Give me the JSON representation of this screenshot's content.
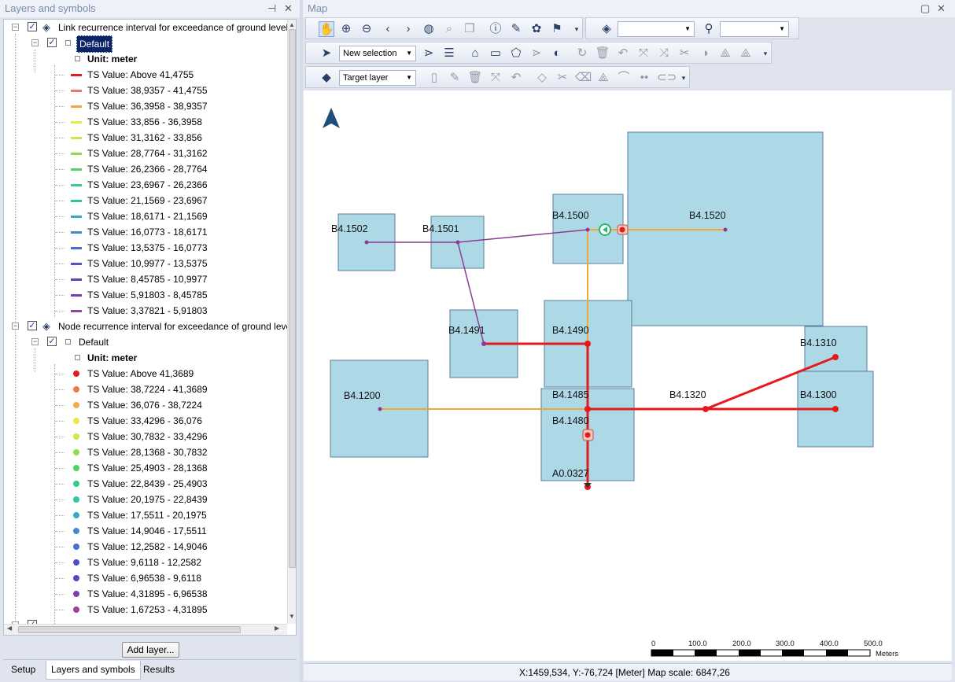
{
  "left_panel": {
    "title": "Layers and symbols",
    "layer1": {
      "name": "Link recurrence interval for exceedance of ground levels",
      "group": "Default",
      "unit": "Unit: meter",
      "items": [
        {
          "label": "TS Value: Above 41,4755",
          "color": "#e41a1c"
        },
        {
          "label": "TS Value: 38,9357 - 41,4755",
          "color": "#f0746a"
        },
        {
          "label": "TS Value: 36,3958 - 38,9357",
          "color": "#f5a442"
        },
        {
          "label": "TS Value: 33,856 - 36,3958",
          "color": "#eaea4a"
        },
        {
          "label": "TS Value: 31,3162 - 33,856",
          "color": "#c6e84a"
        },
        {
          "label": "TS Value: 28,7764 - 31,3162",
          "color": "#8cdc50"
        },
        {
          "label": "TS Value: 26,2366 - 28,7764",
          "color": "#58d060"
        },
        {
          "label": "TS Value: 23,6967 - 26,2366",
          "color": "#3ccc82"
        },
        {
          "label": "TS Value: 21,1569 - 23,6967",
          "color": "#33c1a6"
        },
        {
          "label": "TS Value: 18,6171 - 21,1569",
          "color": "#3aa8c8"
        },
        {
          "label": "TS Value: 16,0773 - 18,6171",
          "color": "#4488cc"
        },
        {
          "label": "TS Value: 13,5375 - 16,0773",
          "color": "#4a6ecf"
        },
        {
          "label": "TS Value: 10,9977 - 13,5375",
          "color": "#4c54c8"
        },
        {
          "label": "TS Value: 8,45785 - 10,9977",
          "color": "#5646be"
        },
        {
          "label": "TS Value: 5,91803 - 8,45785",
          "color": "#7040b4"
        },
        {
          "label": "TS Value: 3,37821 - 5,91803",
          "color": "#9340a8"
        }
      ]
    },
    "layer2": {
      "name": "Node recurrence interval for exceedance of ground levels",
      "group": "Default",
      "unit": "Unit: meter",
      "items": [
        {
          "label": "TS Value: Above 41,3689",
          "color": "#e41a1c"
        },
        {
          "label": "TS Value: 38,7224 - 41,3689",
          "color": "#f07a48"
        },
        {
          "label": "TS Value: 36,076 - 38,7224",
          "color": "#f5ac46"
        },
        {
          "label": "TS Value: 33,4296 - 36,076",
          "color": "#ede84a"
        },
        {
          "label": "TS Value: 30,7832 - 33,4296",
          "color": "#c8ec4a"
        },
        {
          "label": "TS Value: 28,1368 - 30,7832",
          "color": "#8ce050"
        },
        {
          "label": "TS Value: 25,4903 - 28,1368",
          "color": "#4ed462"
        },
        {
          "label": "TS Value: 22,8439 - 25,4903",
          "color": "#38ca86"
        },
        {
          "label": "TS Value: 20,1975 - 22,8439",
          "color": "#34c4a8"
        },
        {
          "label": "TS Value: 17,5511 - 20,1975",
          "color": "#3aaac6"
        },
        {
          "label": "TS Value: 14,9046 - 17,5511",
          "color": "#4488cc"
        },
        {
          "label": "TS Value: 12,2582 - 14,9046",
          "color": "#4a6ed0"
        },
        {
          "label": "TS Value: 9,6118 - 12,2582",
          "color": "#4c50c8"
        },
        {
          "label": "TS Value: 6,96538 - 9,6118",
          "color": "#6042bc"
        },
        {
          "label": "TS Value: 4,31895 - 6,96538",
          "color": "#8040b0"
        },
        {
          "label": "TS Value: 1,67253 - 4,31895",
          "color": "#a040a4"
        }
      ]
    },
    "add_layer_label": "Add layer...",
    "tabs": [
      "Setup",
      "Layers and symbols",
      "Results"
    ]
  },
  "map_panel": {
    "title": "Map",
    "selection_mode": "New selection",
    "target_layer": "Target layer",
    "status": "X:1459,534, Y:-76,724 [Meter]   Map scale: 6847,26",
    "scale_labels": [
      "0",
      "100.0",
      "200.0",
      "300.0",
      "400.0",
      "500.0"
    ],
    "scale_unit": "Meters",
    "catchments": [
      "B4.1502",
      "B4.1501",
      "B4.1500",
      "B4.1520",
      "B4.1491",
      "B4.1490",
      "B4.1310",
      "B4.1200",
      "B4.1485",
      "B4.1320",
      "B4.1300",
      "B4.1480",
      "A0.0327"
    ]
  }
}
